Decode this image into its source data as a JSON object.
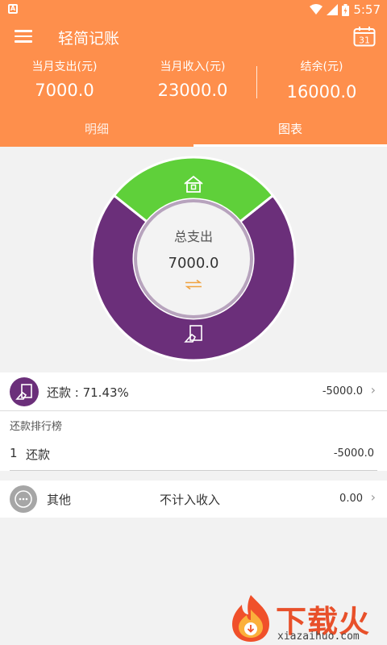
{
  "status_bar": {
    "time": "5:57",
    "left_icon": "A"
  },
  "header": {
    "title": "轻简记账",
    "calendar_day": "31",
    "stats": [
      {
        "label": "当月支出(元)",
        "value": "7000.0"
      },
      {
        "label": "当月收入(元)",
        "value": "23000.0"
      },
      {
        "label": "结余(元)",
        "value": "16000.0"
      }
    ],
    "tabs": [
      {
        "label": "明细"
      },
      {
        "label": "图表"
      }
    ],
    "active_tab": "图表"
  },
  "chart_data": {
    "type": "pie",
    "style": "donut",
    "center_title": "总支出",
    "center_value": "7000.0",
    "slices": [
      {
        "name": "还款",
        "value": 71.43,
        "color": "#6b2f7a",
        "icon": "repayment-icon"
      },
      {
        "name": "",
        "value": 28.57,
        "color": "#5fd03a",
        "icon": "house-icon"
      }
    ]
  },
  "summary_row": {
    "name": "还款 : 71.43%",
    "amount": "-5000.0",
    "icon_color": "#6b2f7a"
  },
  "ranking": {
    "title": "还款排行榜",
    "items": [
      {
        "index": "1",
        "name": "还款",
        "amount": "-5000.0"
      }
    ]
  },
  "other_row": {
    "name": "其他",
    "note": "不计入收入",
    "amount": "0.00",
    "icon_color": "#a6a6a6"
  },
  "watermark": {
    "brand": "下载火",
    "domain": "xiazaihuo.com"
  },
  "colors": {
    "accent": "#fe8f4c",
    "purple": "#6b2f7a",
    "green": "#5fd03a",
    "gray_icon": "#a6a6a6"
  }
}
